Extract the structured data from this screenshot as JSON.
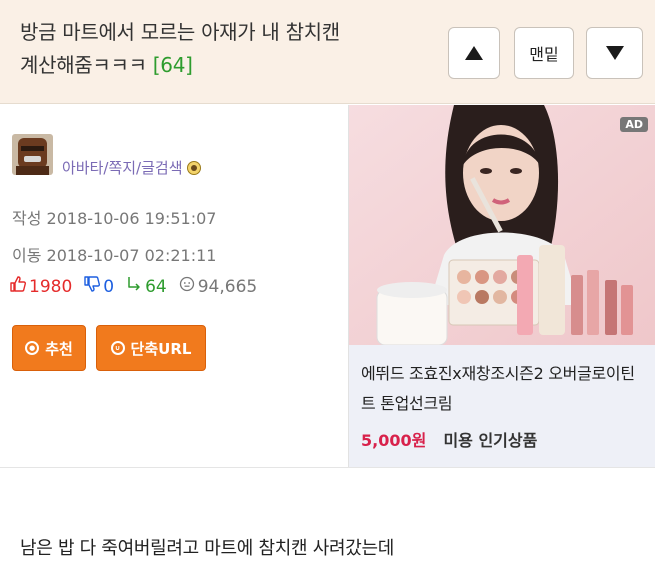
{
  "header": {
    "title_line1": "방금 마트에서 모르는 아재가 내 참치캔",
    "title_line2": "계산해줌ㅋㅋㅋ",
    "comment_count": "[64]",
    "bottom_button": "맨밑"
  },
  "author": {
    "links": "아바타/쪽지/글검색"
  },
  "meta": {
    "written": "작성 2018-10-06 19:51:07",
    "moved": "이동 2018-10-07 02:21:11"
  },
  "stats": {
    "upvotes": "1980",
    "downvotes": "0",
    "replies": "64",
    "views": "94,665"
  },
  "actions": {
    "recommend": "추천",
    "short_url": "단축URL"
  },
  "ad": {
    "tag": "AD",
    "description": "에뛰드 조효진x재창조시즌2 오버글로이틴트 톤업선크림",
    "price": "5,000원",
    "category": "미용 인기상품"
  },
  "content": {
    "text": "남은 밥 다 죽여버릴려고 마트에 참치캔 사려갔는데"
  }
}
